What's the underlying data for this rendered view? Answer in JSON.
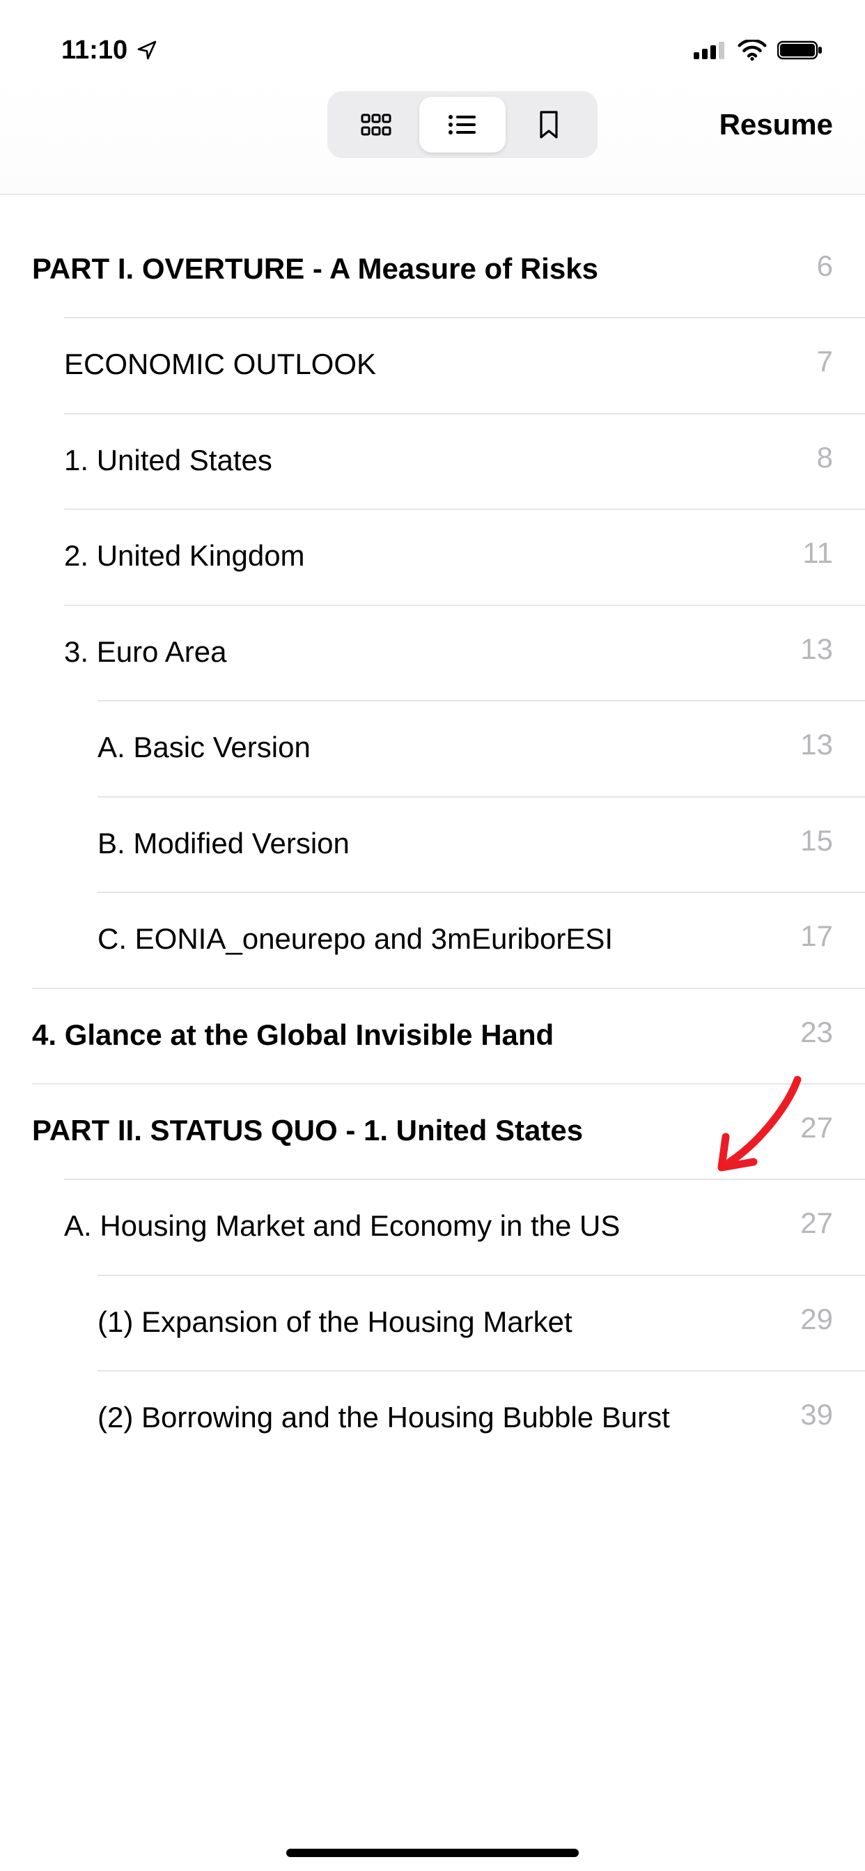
{
  "status": {
    "time": "11:10"
  },
  "toolbar": {
    "resume_label": "Resume"
  },
  "toc": [
    {
      "title": "PART I. OVERTURE - A Measure of Risks",
      "page": "6",
      "level": 0,
      "bold": true
    },
    {
      "title": "ECONOMIC OUTLOOK",
      "page": "7",
      "level": 1,
      "bold": false
    },
    {
      "title": "1. United States",
      "page": "8",
      "level": 1,
      "bold": false
    },
    {
      "title": "2. United Kingdom",
      "page": "11",
      "level": 1,
      "bold": false
    },
    {
      "title": "3. Euro Area",
      "page": "13",
      "level": 1,
      "bold": false
    },
    {
      "title": "A. Basic Version",
      "page": "13",
      "level": 2,
      "bold": false
    },
    {
      "title": "B. Modified Version",
      "page": "15",
      "level": 2,
      "bold": false
    },
    {
      "title": "C. EONIA_oneurepo and 3mEuriborESI",
      "page": "17",
      "level": 2,
      "bold": false
    },
    {
      "title": "4. Glance at the Global Invisible Hand",
      "page": "23",
      "level": 0,
      "bold": true
    },
    {
      "title": "PART II. STATUS QUO - 1. United States",
      "page": "27",
      "level": 0,
      "bold": true
    },
    {
      "title": "A. Housing Market and Economy in the US",
      "page": "27",
      "level": 1,
      "bold": false
    },
    {
      "title": "(1) Expansion of the Housing Market",
      "page": "29",
      "level": 2,
      "bold": false
    },
    {
      "title": "(2) Borrowing and the Housing Bubble Burst",
      "page": "39",
      "level": 2,
      "bold": false
    }
  ]
}
